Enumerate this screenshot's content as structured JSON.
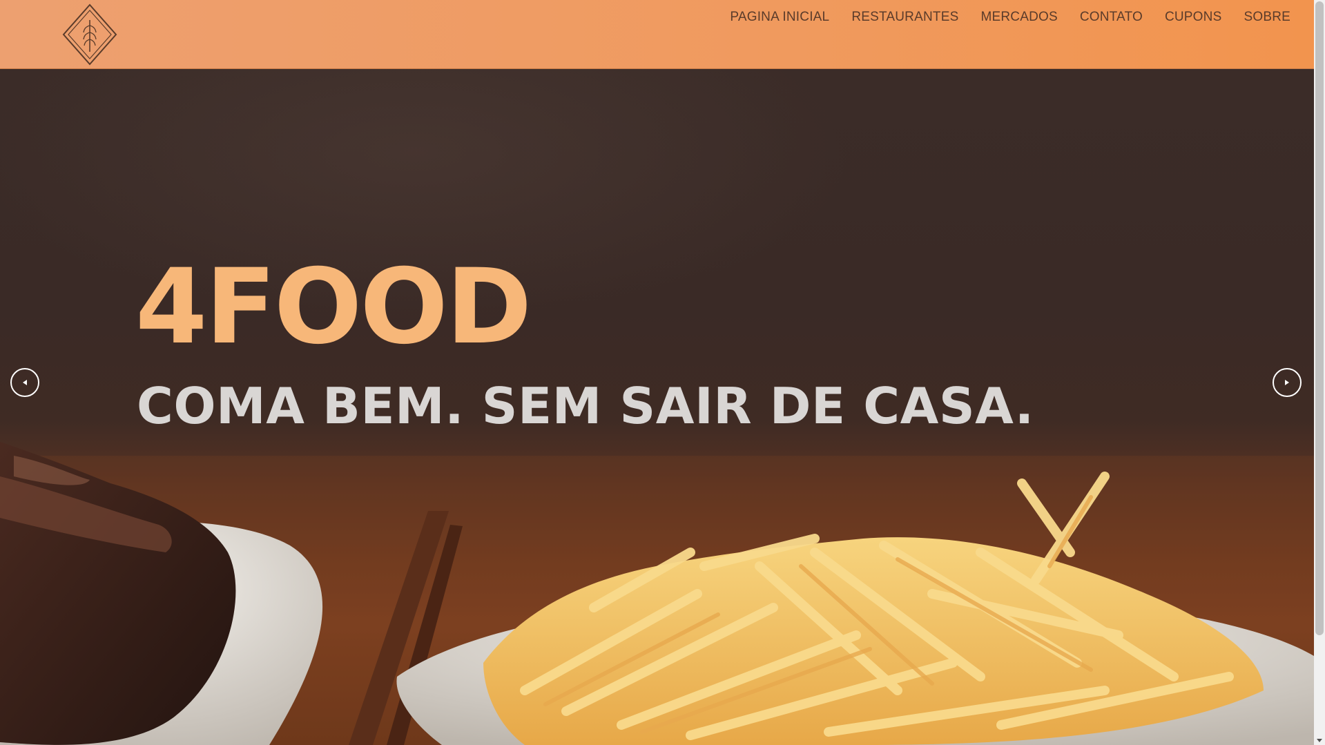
{
  "header": {
    "logo_icon": "diamond-wheat-icon",
    "background_color": "#f09a5e"
  },
  "nav": {
    "items": [
      {
        "label": "PAGINA INICIAL"
      },
      {
        "label": "RESTAURANTES"
      },
      {
        "label": "MERCADOS"
      },
      {
        "label": "CONTATO"
      },
      {
        "label": "CUPONS"
      },
      {
        "label": "SOBRE"
      }
    ]
  },
  "hero": {
    "title": "4FOOD",
    "subtitle": "COMA BEM. SEM SAIR DE CASA.",
    "title_color": "#f7b779",
    "subtitle_color": "#d9d6d4",
    "prev_icon": "chevron-left-icon",
    "next_icon": "chevron-right-icon"
  }
}
